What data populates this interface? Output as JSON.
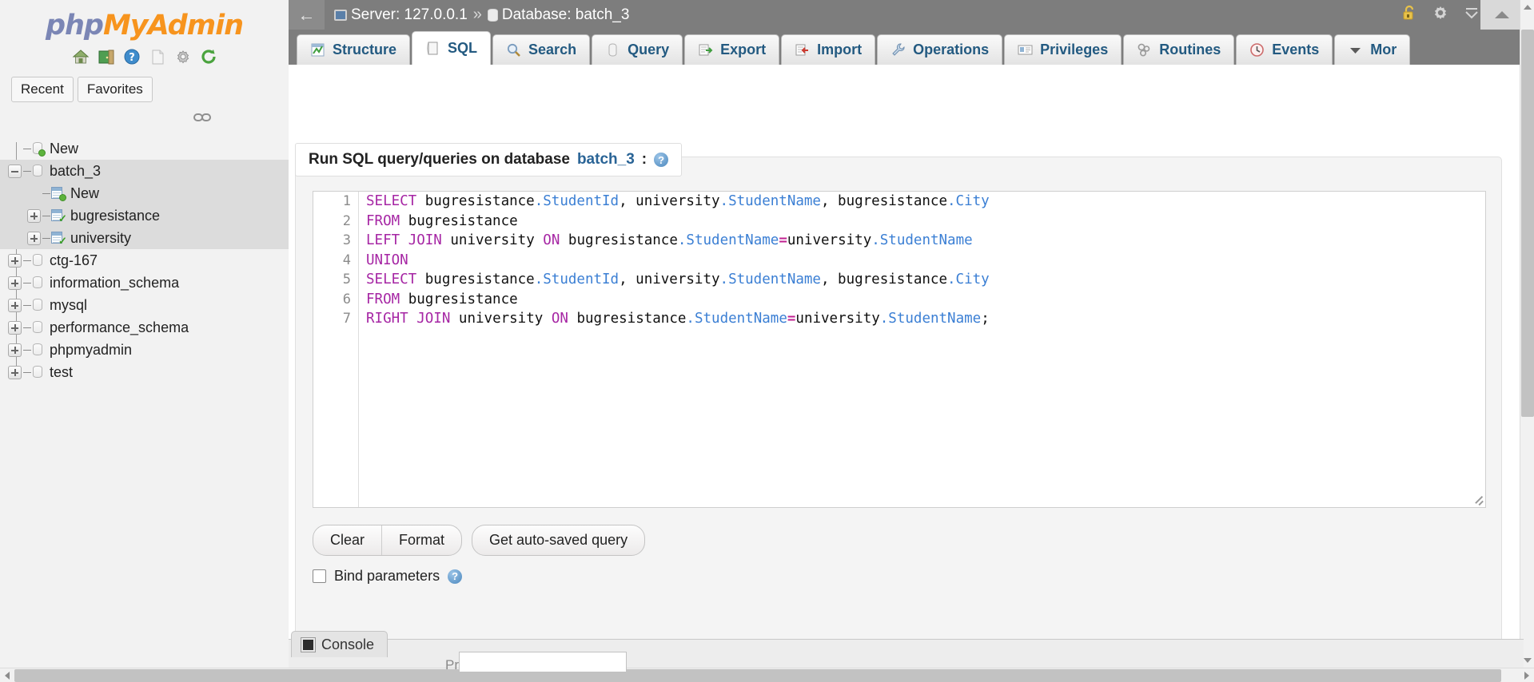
{
  "brand": {
    "logo_php": "php",
    "logo_myadmin": "MyAdmin",
    "icons": [
      {
        "name": "home-icon",
        "label": "Home"
      },
      {
        "name": "logout-icon",
        "label": "Log out"
      },
      {
        "name": "help-docs-icon",
        "label": "phpMyAdmin documentation"
      },
      {
        "name": "sql-docs-icon",
        "label": "Documentation"
      },
      {
        "name": "settings-icon",
        "label": "Settings"
      },
      {
        "name": "refresh-icon",
        "label": "Reload navigation"
      }
    ]
  },
  "quicktabs": [
    {
      "label": "Recent"
    },
    {
      "label": "Favorites"
    }
  ],
  "navigation": {
    "link_icon_label": "Link with main panel",
    "tree": [
      {
        "label": "New",
        "type": "new-database",
        "depth": 0,
        "toggle": "none",
        "selected": false
      },
      {
        "label": "batch_3",
        "type": "database",
        "depth": 0,
        "toggle": "minus",
        "selected": true
      },
      {
        "label": "New",
        "type": "new-table",
        "depth": 1,
        "toggle": "none",
        "selected": true
      },
      {
        "label": "bugresistance",
        "type": "table",
        "depth": 1,
        "toggle": "plus",
        "selected": true
      },
      {
        "label": "university",
        "type": "table",
        "depth": 1,
        "toggle": "plus",
        "selected": true
      },
      {
        "label": "ctg-167",
        "type": "database",
        "depth": 0,
        "toggle": "plus",
        "selected": false
      },
      {
        "label": "information_schema",
        "type": "database",
        "depth": 0,
        "toggle": "plus",
        "selected": false
      },
      {
        "label": "mysql",
        "type": "database",
        "depth": 0,
        "toggle": "plus",
        "selected": false
      },
      {
        "label": "performance_schema",
        "type": "database",
        "depth": 0,
        "toggle": "plus",
        "selected": false
      },
      {
        "label": "phpmyadmin",
        "type": "database",
        "depth": 0,
        "toggle": "plus",
        "selected": false
      },
      {
        "label": "test",
        "type": "database",
        "depth": 0,
        "toggle": "plus",
        "selected": false
      }
    ]
  },
  "serverbar": {
    "back_label": "←",
    "server_label": "Server: 127.0.0.1",
    "separator": "»",
    "database_label": "Database: batch_3",
    "icons": [
      {
        "name": "unlocked-padlock-icon",
        "label": "Connection not secured"
      },
      {
        "name": "gear-icon",
        "label": "Settings"
      },
      {
        "name": "collapse-up-icon",
        "label": "Collapse"
      }
    ]
  },
  "tabs": [
    {
      "label": "Structure",
      "icon": "structure-icon",
      "active": false
    },
    {
      "label": "SQL",
      "icon": "sql-icon",
      "active": true
    },
    {
      "label": "Search",
      "icon": "magnifier-icon",
      "active": false
    },
    {
      "label": "Query",
      "icon": "query-database-icon",
      "active": false
    },
    {
      "label": "Export",
      "icon": "export-icon",
      "active": false
    },
    {
      "label": "Import",
      "icon": "import-icon",
      "active": false
    },
    {
      "label": "Operations",
      "icon": "wrench-icon",
      "active": false
    },
    {
      "label": "Privileges",
      "icon": "privileges-icon",
      "active": false
    },
    {
      "label": "Routines",
      "icon": "routines-icon",
      "active": false
    },
    {
      "label": "Events",
      "icon": "clock-icon",
      "active": false
    },
    {
      "label": "Mor",
      "icon": "chevron-down-icon",
      "active": false
    }
  ],
  "query_panel": {
    "heading_prefix": "Run SQL query/queries on database",
    "heading_db": "batch_3",
    "heading_suffix": ":",
    "help_icon_label": "Documentation",
    "line_numbers": [
      "1",
      "2",
      "3",
      "4",
      "5",
      "6",
      "7"
    ],
    "sql_lines": [
      [
        {
          "t": "SELECT",
          "c": "kw"
        },
        {
          "t": " bugresistance",
          "c": ""
        },
        {
          "t": ".StudentId",
          "c": "col"
        },
        {
          "t": ", university",
          "c": ""
        },
        {
          "t": ".StudentName",
          "c": "col"
        },
        {
          "t": ", bugresistance",
          "c": ""
        },
        {
          "t": ".City",
          "c": "col"
        }
      ],
      [
        {
          "t": "FROM",
          "c": "kw"
        },
        {
          "t": " bugresistance",
          "c": ""
        }
      ],
      [
        {
          "t": "LEFT",
          "c": "kw"
        },
        {
          "t": " ",
          "c": ""
        },
        {
          "t": "JOIN",
          "c": "kw"
        },
        {
          "t": " university ",
          "c": ""
        },
        {
          "t": "ON",
          "c": "kw"
        },
        {
          "t": " bugresistance",
          "c": ""
        },
        {
          "t": ".StudentName",
          "c": "col"
        },
        {
          "t": "=",
          "c": "op"
        },
        {
          "t": "university",
          "c": ""
        },
        {
          "t": ".StudentName",
          "c": "col"
        }
      ],
      [
        {
          "t": "UNION",
          "c": "kw"
        }
      ],
      [
        {
          "t": "SELECT",
          "c": "kw"
        },
        {
          "t": " bugresistance",
          "c": ""
        },
        {
          "t": ".StudentId",
          "c": "col"
        },
        {
          "t": ", university",
          "c": ""
        },
        {
          "t": ".StudentName",
          "c": "col"
        },
        {
          "t": ", bugresistance",
          "c": ""
        },
        {
          "t": ".City",
          "c": "col"
        }
      ],
      [
        {
          "t": "FROM",
          "c": "kw"
        },
        {
          "t": " bugresistance",
          "c": ""
        }
      ],
      [
        {
          "t": "RIGHT",
          "c": "kw"
        },
        {
          "t": " ",
          "c": ""
        },
        {
          "t": "JOIN",
          "c": "kw"
        },
        {
          "t": " university ",
          "c": ""
        },
        {
          "t": "ON",
          "c": "kw"
        },
        {
          "t": " bugresistance",
          "c": ""
        },
        {
          "t": ".StudentName",
          "c": "col"
        },
        {
          "t": "=",
          "c": "op"
        },
        {
          "t": "university",
          "c": ""
        },
        {
          "t": ".StudentName",
          "c": "col"
        },
        {
          "t": ";",
          "c": ""
        }
      ]
    ],
    "buttons": {
      "clear": "Clear",
      "format": "Format",
      "autosaved": "Get auto-saved query"
    },
    "bind_parameters_label": "Bind parameters",
    "bind_parameters_checked": false
  },
  "console": {
    "label": "Console",
    "hint": "Press Ctrl+Enter"
  }
}
